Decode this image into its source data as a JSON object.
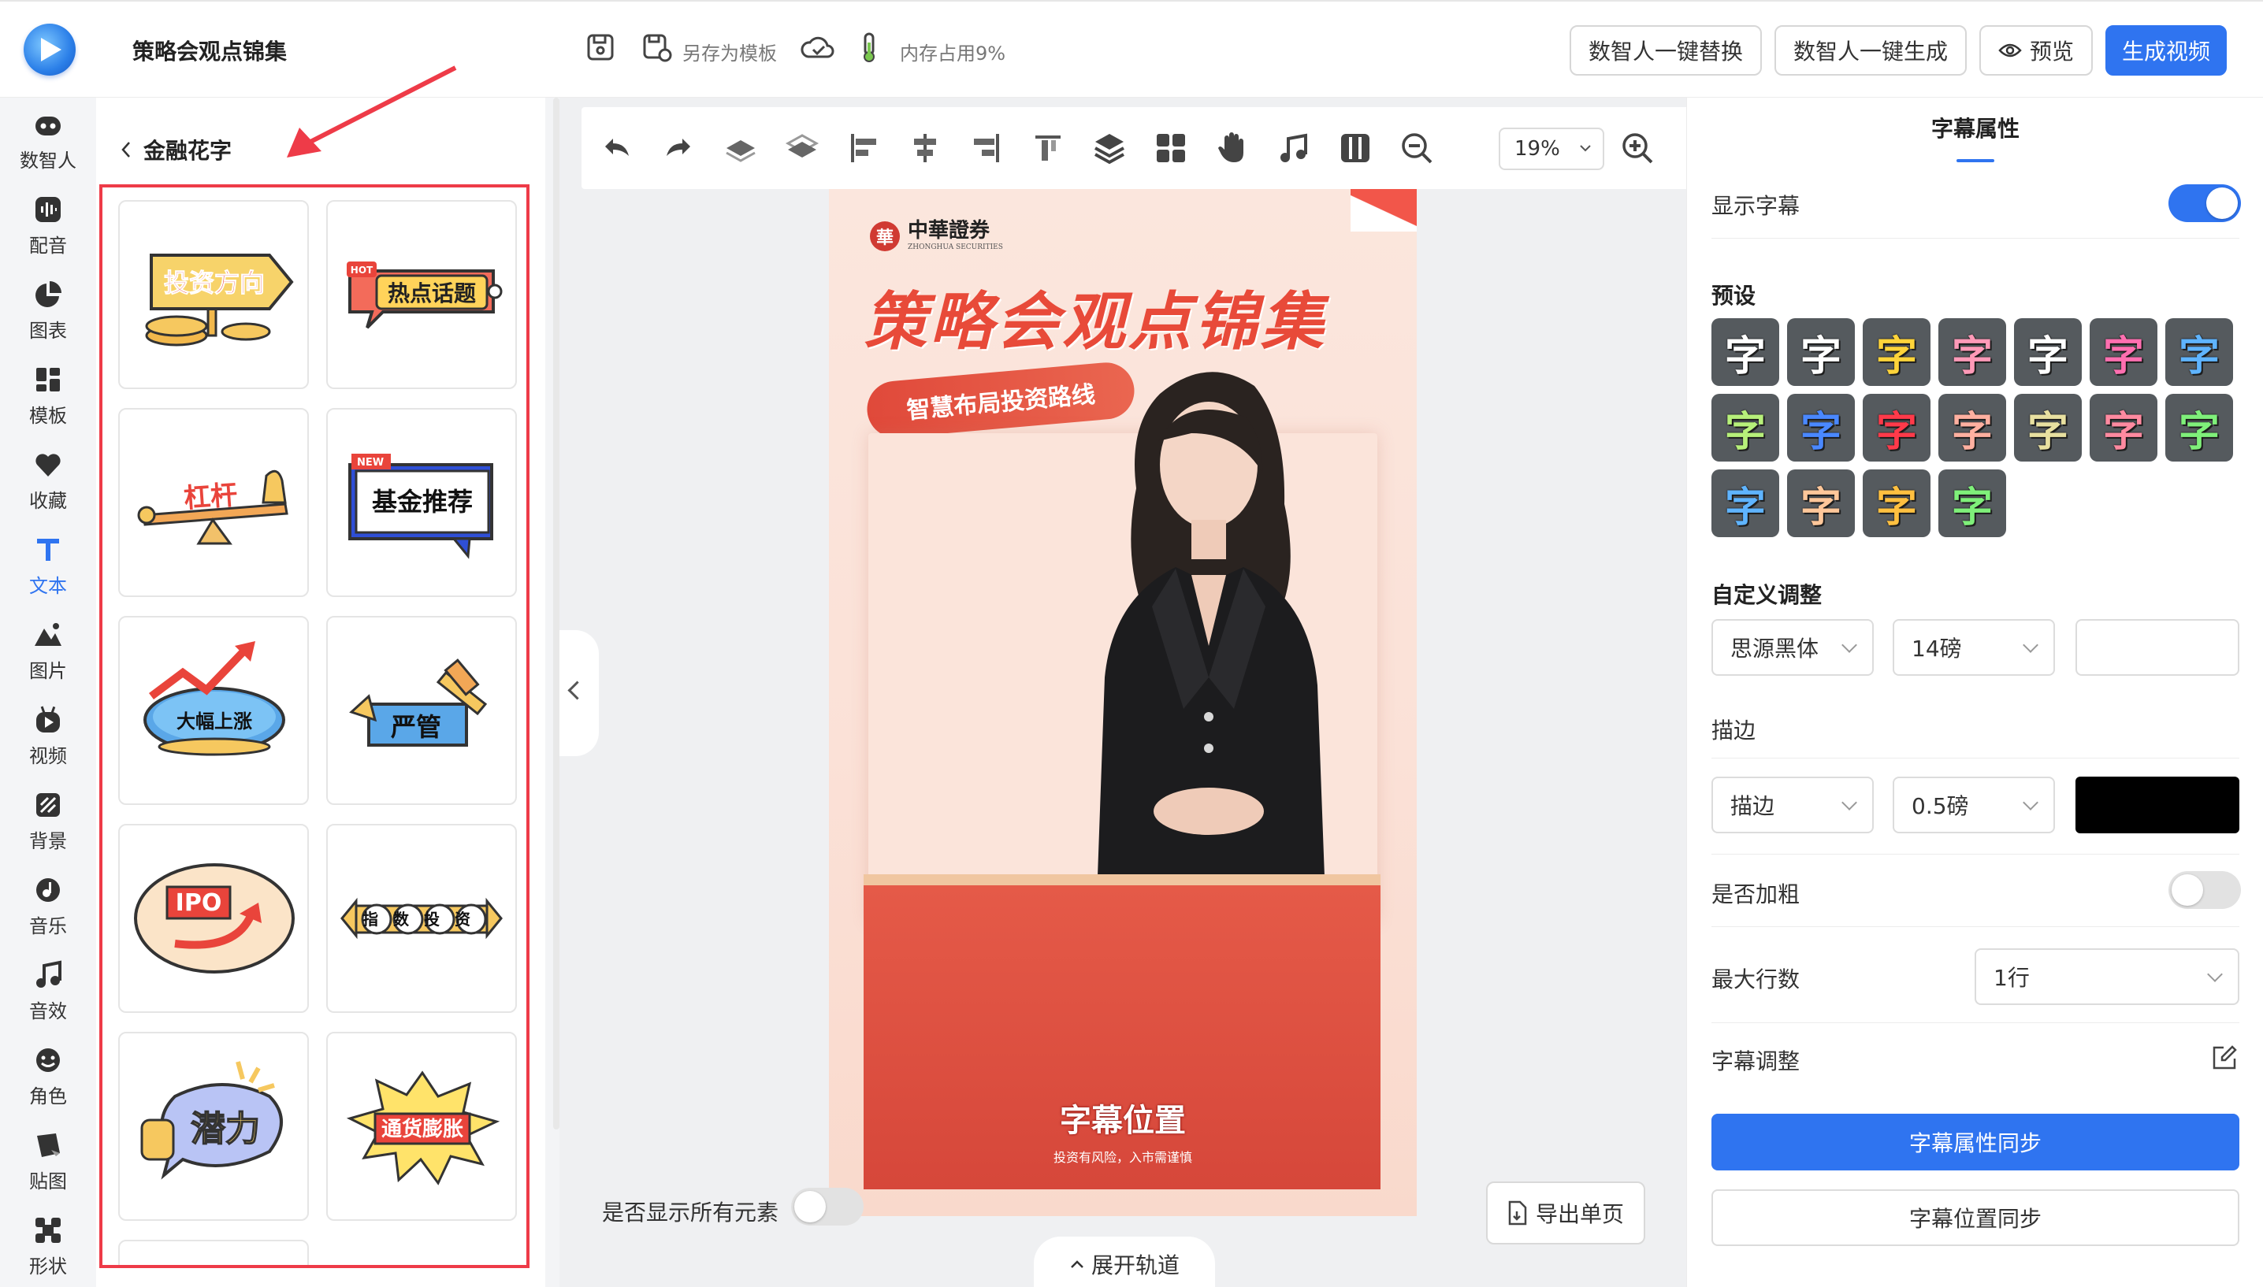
{
  "header": {
    "title": "策略会观点锦集",
    "save_as_template": "另存为模板",
    "memory": "内存占用9%",
    "buttons": {
      "replace_avatar": "数智人一键替换",
      "generate_avatar": "数智人一键生成",
      "preview": "预览",
      "generate_video": "生成视频"
    }
  },
  "rail": {
    "items": [
      {
        "label": "数智人",
        "icon": "robot-icon"
      },
      {
        "label": "配音",
        "icon": "voice-icon"
      },
      {
        "label": "图表",
        "icon": "pie-chart-icon"
      },
      {
        "label": "模板",
        "icon": "template-icon"
      },
      {
        "label": "收藏",
        "icon": "heart-icon"
      },
      {
        "label": "文本",
        "icon": "text-icon",
        "active": true
      },
      {
        "label": "图片",
        "icon": "image-icon"
      },
      {
        "label": "视频",
        "icon": "video-icon"
      },
      {
        "label": "背景",
        "icon": "background-icon"
      },
      {
        "label": "音乐",
        "icon": "music-icon"
      },
      {
        "label": "音效",
        "icon": "sound-effect-icon"
      },
      {
        "label": "角色",
        "icon": "character-icon"
      },
      {
        "label": "贴图",
        "icon": "sticker-icon"
      },
      {
        "label": "形状",
        "icon": "shape-icon"
      }
    ]
  },
  "panel": {
    "back_label": "金融花字",
    "tiles": [
      "投资方向",
      "热点话题",
      "杠杆",
      "基金推荐",
      "大幅上涨",
      "严管",
      "IPO",
      "指数投资",
      "潜力",
      "通货膨胀"
    ],
    "tile_badges": {
      "hot": "HOT",
      "new": "NEW"
    }
  },
  "toolbar": {
    "zoom": "19%"
  },
  "poster": {
    "brand": "中華證券",
    "brand_mark": "華",
    "brand_sub": "ZHONGHUA SECURITIES",
    "title": "策略会观点锦集",
    "ribbon": "智慧布局投资路线",
    "caption": "字幕位置",
    "disclaimer": "投资有风险，入市需谨慎"
  },
  "canvas_footer": {
    "show_all": "是否显示所有元素",
    "export": "导出单页",
    "expand_track": "展开轨道"
  },
  "right": {
    "title": "字幕属性",
    "show_subtitle": "显示字幕",
    "presets_label": "预设",
    "preset_glyph": "字",
    "preset_colors": [
      "#ffffff",
      "#ffffff",
      "#ffd43a",
      "#ff9ab8",
      "#ffffff",
      "#ff6fb0",
      "#5fb4ff",
      "#b7f07a",
      "#4a88ff",
      "#ff3a4a",
      "#ffb0a0",
      "#e8e0a0",
      "#ff8aa0",
      "#7ff07a",
      "#5fb4ff",
      "#ffc79a",
      "#ffc040",
      "#7ff07a"
    ],
    "custom_label": "自定义调整",
    "font": "思源黑体",
    "size": "14磅",
    "stroke_label": "描边",
    "stroke_type": "描边",
    "stroke_width": "0.5磅",
    "stroke_color": "#000000",
    "bold_label": "是否加粗",
    "max_lines_label": "最大行数",
    "max_lines": "1行",
    "adjust_label": "字幕调整",
    "sync_props": "字幕属性同步",
    "sync_position": "字幕位置同步"
  }
}
